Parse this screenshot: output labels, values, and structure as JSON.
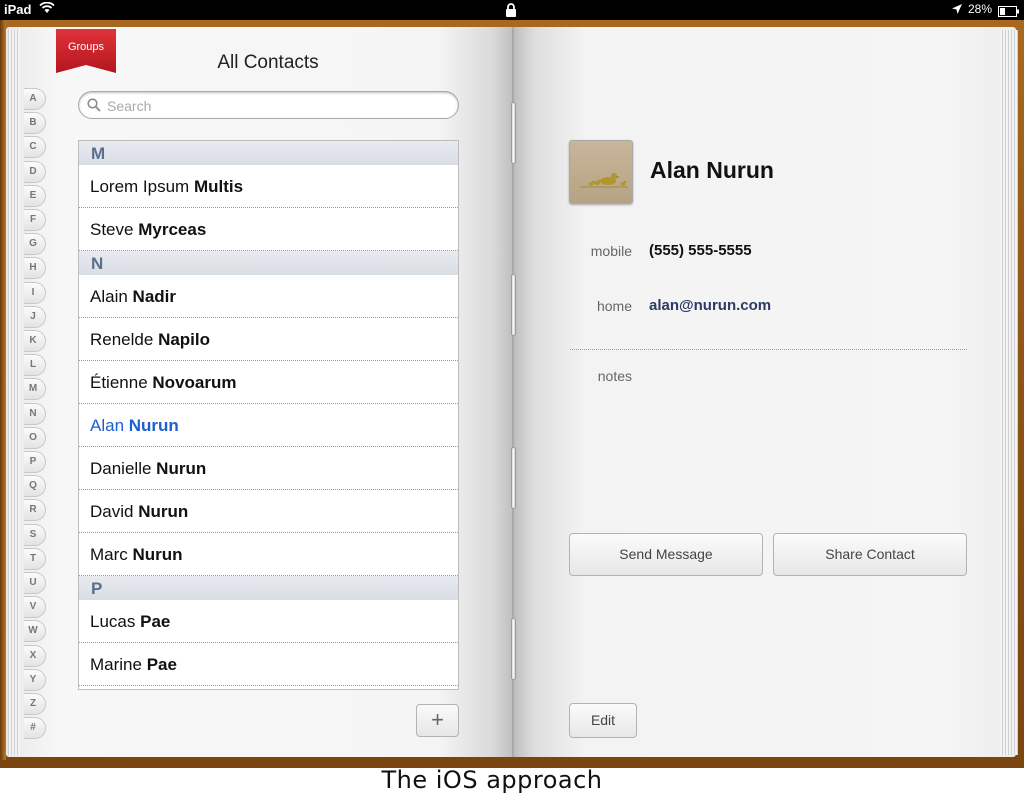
{
  "status_bar": {
    "carrier": "iPad",
    "battery_percent": "28%"
  },
  "groups_label": "Groups",
  "contacts_title": "All Contacts",
  "search": {
    "placeholder": "Search",
    "value": ""
  },
  "alpha_index": [
    "A",
    "B",
    "C",
    "D",
    "E",
    "F",
    "G",
    "H",
    "I",
    "J",
    "K",
    "L",
    "M",
    "N",
    "O",
    "P",
    "Q",
    "R",
    "S",
    "T",
    "U",
    "V",
    "W",
    "X",
    "Y",
    "Z",
    "#"
  ],
  "contacts_list": [
    {
      "type": "header",
      "label": "M"
    },
    {
      "type": "row",
      "first": "Lorem Ipsum",
      "last": "Multis"
    },
    {
      "type": "row",
      "first": "Steve",
      "last": "Myrceas"
    },
    {
      "type": "header",
      "label": "N"
    },
    {
      "type": "row",
      "first": "Alain",
      "last": "Nadir"
    },
    {
      "type": "row",
      "first": "Renelde",
      "last": "Napilo"
    },
    {
      "type": "row",
      "first": "Étienne",
      "last": "Novoarum"
    },
    {
      "type": "row",
      "first": "Alan",
      "last": "Nurun",
      "selected": true
    },
    {
      "type": "row",
      "first": "Danielle",
      "last": "Nurun"
    },
    {
      "type": "row",
      "first": "David",
      "last": "Nurun"
    },
    {
      "type": "row",
      "first": "Marc",
      "last": "Nurun"
    },
    {
      "type": "header",
      "label": "P"
    },
    {
      "type": "row",
      "first": "Lucas",
      "last": "Pae"
    },
    {
      "type": "row",
      "first": "Marine",
      "last": "Pae"
    }
  ],
  "add_button_label": "+",
  "contact_detail": {
    "name": "Alan Nurun",
    "mobile_label": "mobile",
    "mobile_value": "(555) 555-5555",
    "home_label": "home",
    "home_value": "alan@nurun.com",
    "notes_label": "notes",
    "send_message_label": "Send Message",
    "share_contact_label": "Share Contact",
    "edit_label": "Edit"
  },
  "caption": "The iOS approach",
  "colors": {
    "selected_text": "#1d5fd1",
    "section_header_text": "#5b6e8c",
    "ribbon_red": "#c8202a",
    "book_leather": "#8c5417"
  }
}
